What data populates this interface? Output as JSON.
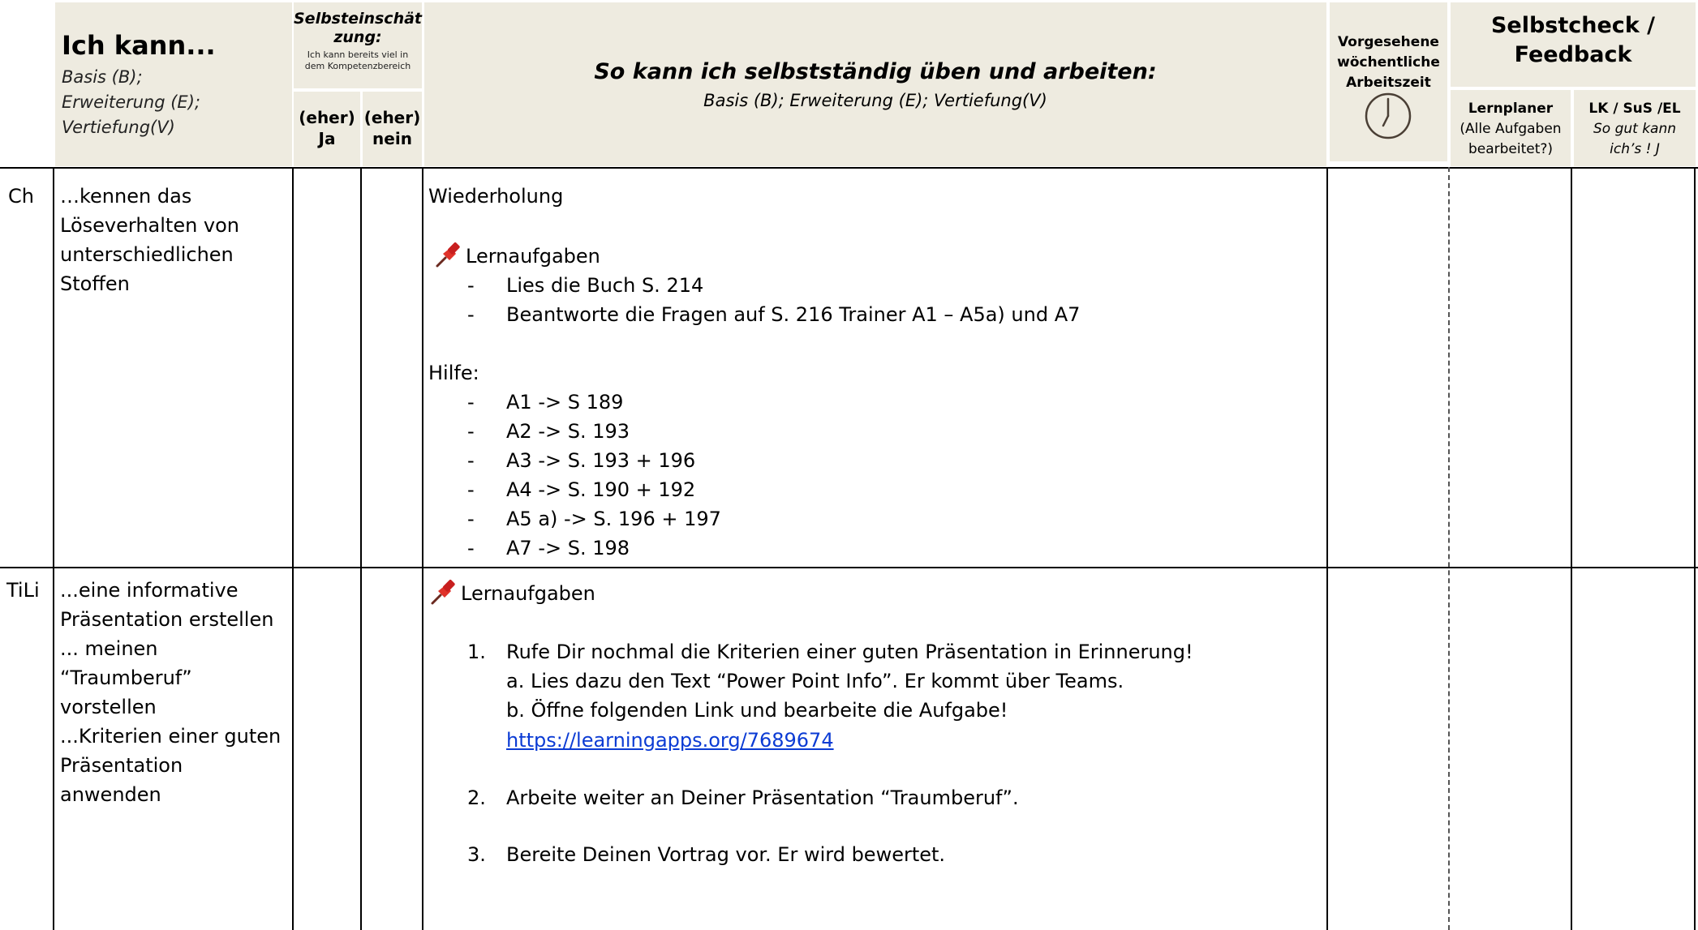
{
  "header": {
    "ich_kann_title": "Ich kann...",
    "ich_kann_sub": [
      "Basis (B);",
      "Erweiterung (E);",
      "Vertiefung(V)"
    ],
    "selbst_title_lines": [
      "Selbsteinschät",
      "zung:"
    ],
    "selbst_note_lines": [
      "Ich kann bereits viel in",
      "dem Kompetenzbereich"
    ],
    "yes_lines": [
      "(eher)",
      "Ja"
    ],
    "no_lines": [
      "(eher)",
      "nein"
    ],
    "main_title": "So kann ich selbstständig üben und arbeiten:",
    "main_sub": "Basis (B); Erweiterung (E); Vertiefung(V)",
    "time_lines": [
      "Vorgesehene",
      "wöchentliche",
      "Arbeitszeit"
    ],
    "time_icon": "clock-icon",
    "check_title_lines": [
      "Selbstcheck /",
      "Feedback"
    ],
    "lernplaner_title": "Lernplaner",
    "lernplaner_sub_lines": [
      "(Alle Aufgaben",
      "bearbeitet?)"
    ],
    "lk_title": "LK / SuS /EL",
    "lk_sub_lines": [
      "So gut kann",
      "ich’s ! J"
    ]
  },
  "rows": [
    {
      "subject": "Ch",
      "competence_lines": [
        "…kennen das",
        "Löseverhalten von",
        "unterschiedlichen",
        "Stoffen"
      ],
      "intro": "Wiederholung",
      "tasks_label": "Lernaufgaben",
      "tasks_icon": "pushpin-icon",
      "tasks": [
        "Lies die Buch S. 214",
        "Beantworte die Fragen auf S. 216 Trainer A1 – A5a) und A7"
      ],
      "help_label": "Hilfe:",
      "help": [
        "A1 -> S 189",
        "A2 -> S. 193",
        "A3 -> S. 193 + 196",
        "A4 -> S. 190 + 192",
        "A5 a) -> S. 196 + 197",
        "A7 -> S. 198"
      ]
    },
    {
      "subject": "TiLi",
      "competence_lines": [
        "...eine informative",
        "Präsentation erstellen",
        "... meinen",
        "“Traumberuf”",
        "vorstellen",
        "...Kriterien einer guten",
        "Präsentation",
        "anwenden"
      ],
      "tasks_label": "Lernaufgaben",
      "tasks_icon": "pushpin-icon",
      "steps": [
        {
          "number": "1.",
          "text": "Rufe Dir nochmal die Kriterien einer guten Präsentation in Erinnerung!",
          "sub": [
            "a.  Lies dazu den Text “Power Point Info”. Er kommt über Teams.",
            "b. Öffne folgenden Link und bearbeite die Aufgabe!"
          ],
          "link": "https://learningapps.org/7689674"
        },
        {
          "number": "2.",
          "text": "Arbeite weiter an Deiner Präsentation “Traumberuf”."
        },
        {
          "number": "3.",
          "text": "Bereite Deinen Vortrag vor. Er wird bewertet."
        }
      ]
    }
  ],
  "colors": {
    "header_bg": "#eeebe0",
    "link": "#0b3bd4",
    "pin": "#e0322a"
  }
}
